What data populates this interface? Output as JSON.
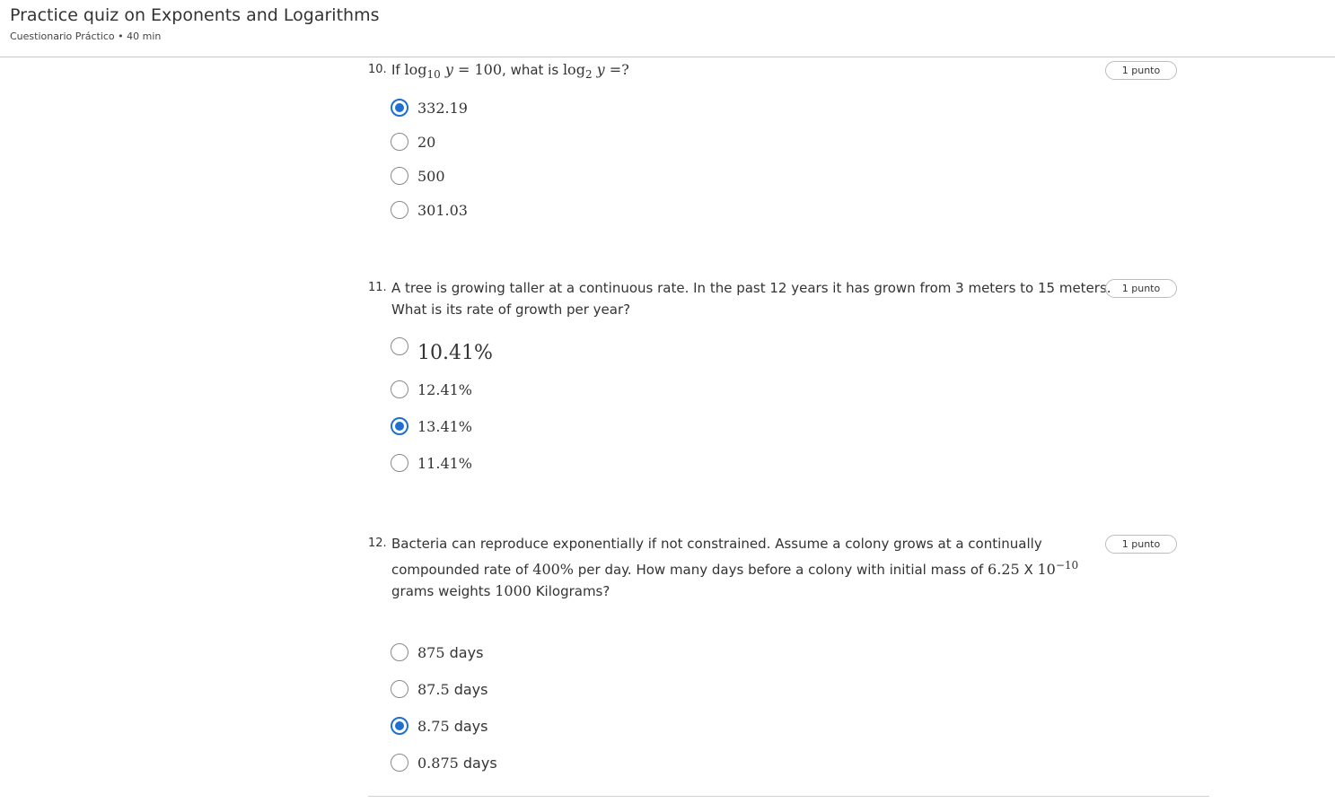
{
  "header": {
    "title": "Practice quiz on Exponents and Logarithms",
    "subtitle": "Cuestionario Práctico • 40 min"
  },
  "questions": [
    {
      "number": "10.",
      "text": {
        "p1": "If ",
        "log10": "log",
        "sub10": "10",
        "y1": "y",
        "eq": " = 100",
        "p2": ", what is ",
        "log2": "log",
        "sub2": "2",
        "y2": "y",
        "eq2": " =?"
      },
      "points": "1 punto",
      "options": [
        {
          "label": "332.19",
          "selected": true
        },
        {
          "label": "20",
          "selected": false
        },
        {
          "label": "500",
          "selected": false
        },
        {
          "label": "301.03",
          "selected": false
        }
      ]
    },
    {
      "number": "11.",
      "text": {
        "line1": "A tree is growing taller at a continuous rate. In the past 12 years it has grown from 3 meters to 15 meters.",
        "line2": "What is its rate of growth per year?"
      },
      "points": "1 punto",
      "options": [
        {
          "label": "10.41%",
          "selected": false
        },
        {
          "label": "12.41%",
          "selected": false
        },
        {
          "label": "13.41%",
          "selected": true
        },
        {
          "label": "11.41%",
          "selected": false
        }
      ]
    },
    {
      "number": "12.",
      "text": {
        "line1": "Bacteria can reproduce exponentially if not constrained. Assume a colony grows at a continually",
        "l2a": "compounded rate of ",
        "l2rate": "400%",
        "l2b": " per day. How many days before a colony with initial mass of ",
        "l2mass": "6.25",
        "l2x": " X ",
        "l2base": "10",
        "l2exp": "−10",
        "l3a": "grams weights ",
        "l3num": "1000",
        "l3b": " Kilograms?"
      },
      "points": "1 punto",
      "options": [
        {
          "num": "875",
          "unit": " days",
          "selected": false
        },
        {
          "num": "87.5",
          "unit": " days",
          "selected": false
        },
        {
          "num": "8.75",
          "unit": " days",
          "selected": true
        },
        {
          "num": "0.875",
          "unit": " days",
          "selected": false
        }
      ]
    }
  ]
}
